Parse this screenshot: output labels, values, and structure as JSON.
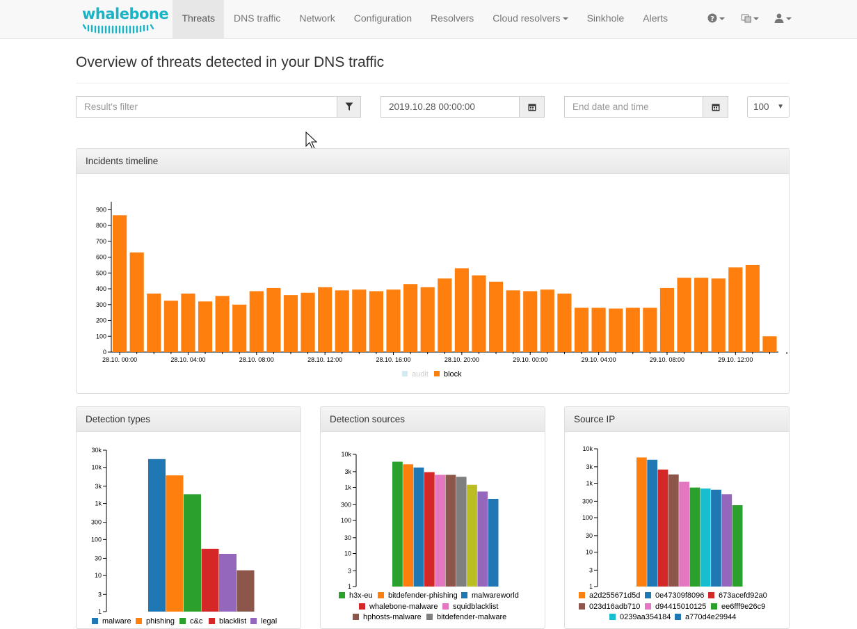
{
  "brand": {
    "name": "whalebone",
    "color": "#1ab3c6"
  },
  "nav": {
    "items": [
      {
        "label": "Threats",
        "active": true
      },
      {
        "label": "DNS traffic"
      },
      {
        "label": "Network"
      },
      {
        "label": "Configuration"
      },
      {
        "label": "Resolvers"
      },
      {
        "label": "Cloud resolvers",
        "dropdown": true
      },
      {
        "label": "Sinkhole"
      },
      {
        "label": "Alerts"
      }
    ],
    "right_icons": [
      "help-icon",
      "language-icon",
      "user-icon"
    ]
  },
  "page": {
    "title": "Overview of threats detected in your DNS traffic"
  },
  "filters": {
    "result_filter_placeholder": "Result's filter",
    "start_date": "2019.10.28 00:00:00",
    "end_date_placeholder": "End date and time",
    "limit": "100"
  },
  "panels": {
    "timeline": "Incidents timeline",
    "detection_types": "Detection types",
    "detection_sources": "Detection sources",
    "source_ip": "Source IP"
  },
  "colors": {
    "block": "#ff7f0e",
    "audit": "#d4eaf2"
  },
  "chart_data": [
    {
      "id": "incidents-timeline",
      "type": "bar",
      "title": "Incidents timeline",
      "ylim": [
        0,
        950
      ],
      "yticks": [
        0,
        100,
        200,
        300,
        400,
        500,
        600,
        700,
        800,
        900
      ],
      "xticks": [
        "28.10. 00:00",
        "28.10. 04:00",
        "28.10. 08:00",
        "28.10. 12:00",
        "28.10. 16:00",
        "28.10. 20:00",
        "29.10. 00:00",
        "29.10. 04:00",
        "29.10. 08:00",
        "29.10. 12:00"
      ],
      "legend": [
        "audit",
        "block"
      ],
      "series": [
        {
          "name": "block",
          "color": "#ff7f0e",
          "values": [
            865,
            630,
            370,
            325,
            370,
            320,
            355,
            300,
            385,
            405,
            360,
            375,
            410,
            390,
            395,
            385,
            395,
            430,
            410,
            465,
            530,
            485,
            445,
            390,
            385,
            395,
            370,
            280,
            280,
            275,
            280,
            280,
            405,
            470,
            470,
            465,
            535,
            550,
            100
          ]
        }
      ]
    },
    {
      "id": "detection-types",
      "type": "bar",
      "title": "Detection types",
      "scale": "log",
      "ylim": [
        1,
        30000
      ],
      "yticks": [
        "1",
        "3",
        "10",
        "30",
        "100",
        "300",
        "1k",
        "3k",
        "10k",
        "30k"
      ],
      "categories": [
        "malware",
        "phishing",
        "c&c",
        "blacklist",
        "legal"
      ],
      "colors": [
        "#1f77b4",
        "#ff7f0e",
        "#2ca02c",
        "#d62728",
        "#9467bd",
        "#8c564b"
      ],
      "values": [
        17000,
        6000,
        1800,
        55,
        40,
        14
      ]
    },
    {
      "id": "detection-sources",
      "type": "bar",
      "title": "Detection sources",
      "scale": "log",
      "ylim": [
        1,
        10000
      ],
      "yticks": [
        "1",
        "3",
        "10",
        "30",
        "100",
        "300",
        "1k",
        "3k",
        "10k"
      ],
      "categories": [
        "h3x-eu",
        "bitdefender-phishing",
        "malwareworld",
        "whalebone-malware",
        "squidblacklist",
        "hphosts-malware",
        "bitdefender-malware"
      ],
      "colors": [
        "#2ca02c",
        "#ff7f0e",
        "#1f77b4",
        "#d62728",
        "#e377c2",
        "#8c564b",
        "#7f7f7f",
        "#bcbd22",
        "#9467bd",
        "#1f77b4"
      ],
      "values": [
        6000,
        5000,
        4000,
        2900,
        2400,
        2400,
        2100,
        1200,
        750,
        450
      ]
    },
    {
      "id": "source-ip",
      "type": "bar",
      "title": "Source IP",
      "scale": "log",
      "ylim": [
        1,
        10000
      ],
      "yticks": [
        "1",
        "3",
        "10",
        "30",
        "100",
        "300",
        "1k",
        "3k",
        "10k"
      ],
      "categories": [
        "a2d255671d5d",
        "0e47309f8096",
        "673acefd92a0",
        "023d16adb710",
        "d94415010125",
        "ee6fff9e26c9",
        "0239aa354184",
        "a770d4e29944"
      ],
      "colors": [
        "#ff7f0e",
        "#1f77b4",
        "#d62728",
        "#8c564b",
        "#e377c2",
        "#2ca02c",
        "#17becf",
        "#1f77b4",
        "#9467bd",
        "#2ca02c"
      ],
      "values": [
        5600,
        4800,
        2500,
        1800,
        1100,
        750,
        700,
        650,
        480,
        230
      ]
    }
  ]
}
